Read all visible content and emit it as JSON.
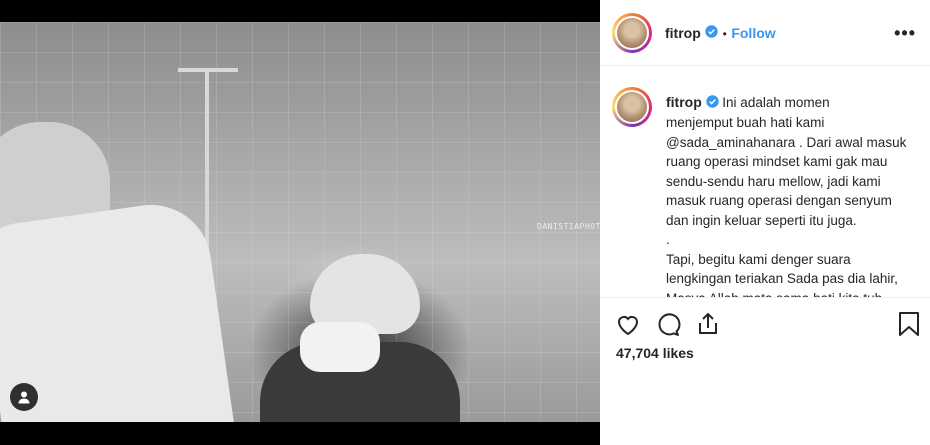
{
  "post": {
    "username": "fitrop",
    "follow_label": "Follow",
    "separator": "•",
    "more_label": "•••",
    "watermark": "DANISTIAPHOTO",
    "caption_lines": [
      "Ini adalah momen",
      "menjemput buah hati kami",
      "@sada_aminahanara . Dari awal masuk",
      "ruang operasi mindset kami gak mau",
      "sendu-sendu haru mellow, jadi kami",
      "masuk ruang operasi dengan senyum",
      "dan ingin keluar seperti itu juga.",
      ".",
      "Tapi, begitu kami denger suara",
      "lengkingan teriakan Sada pas dia lahir,",
      "Masya Allah mata sama hati kita tuh"
    ],
    "likes": "47,704 likes"
  },
  "colors": {
    "accent": "#3897f0",
    "text": "#262626",
    "verified": "#3897f0"
  },
  "icons": {
    "like": "heart-icon",
    "comment": "comment-icon",
    "share": "share-icon",
    "save": "bookmark-icon",
    "tag": "user-tag-icon",
    "verified": "verified-badge-icon"
  }
}
